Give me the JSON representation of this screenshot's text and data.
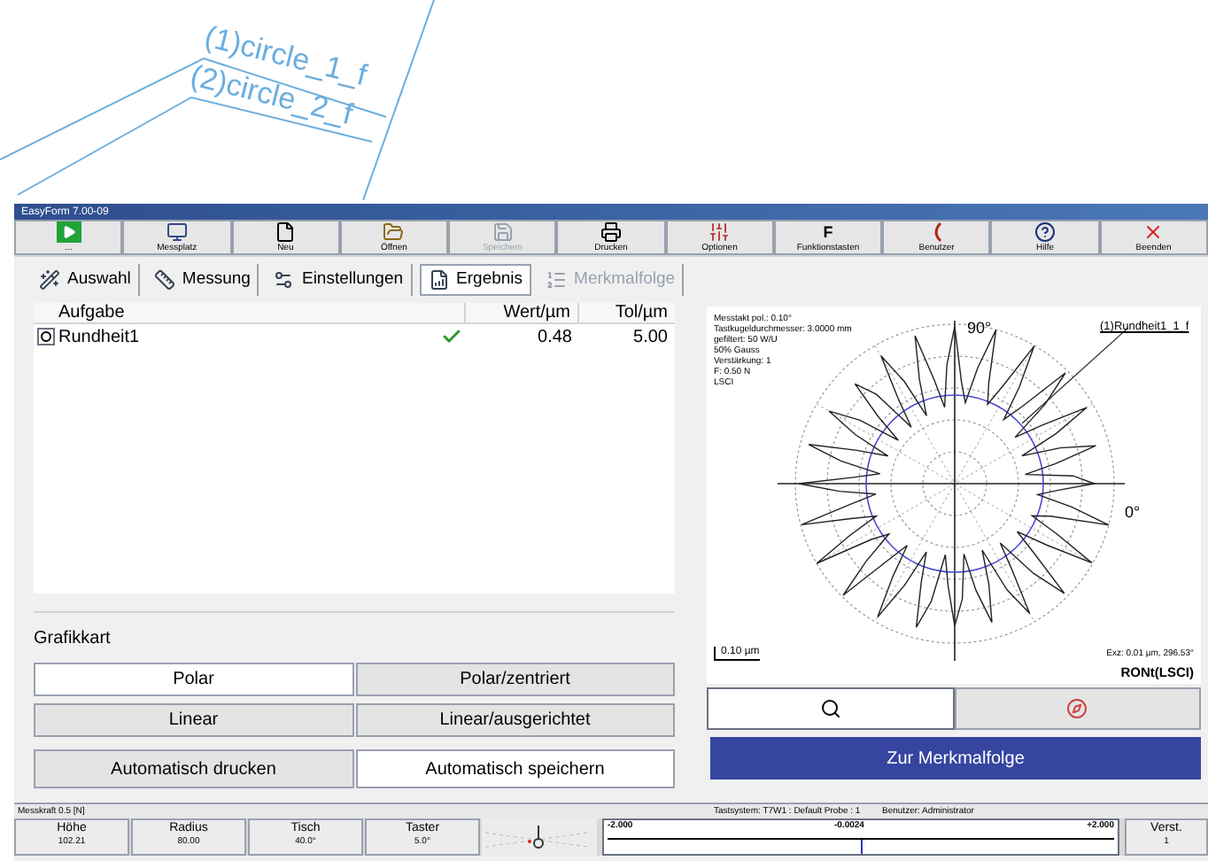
{
  "background_drawing": {
    "labels": [
      "(1)circle_1_f",
      "(2)circle_2_f"
    ]
  },
  "window": {
    "title": "EasyForm 7.00-09"
  },
  "toolbar": [
    {
      "kind": "run",
      "label": "...",
      "disabled": false
    },
    {
      "kind": "station",
      "label": "Messplatz",
      "disabled": false
    },
    {
      "kind": "new",
      "label": "Neu",
      "disabled": false
    },
    {
      "kind": "open",
      "label": "Öffnen",
      "disabled": false
    },
    {
      "kind": "save",
      "label": "Speichern",
      "disabled": true
    },
    {
      "kind": "print",
      "label": "Drucken",
      "disabled": false
    },
    {
      "kind": "options",
      "label": "Optionen",
      "disabled": false
    },
    {
      "kind": "keys",
      "glyph": "F",
      "label": "Funktionstasten",
      "disabled": false
    },
    {
      "kind": "user",
      "label": "Benutzer",
      "disabled": false
    },
    {
      "kind": "help",
      "label": "Hilfe",
      "disabled": false
    },
    {
      "kind": "exit",
      "label": "Beenden",
      "disabled": false
    }
  ],
  "tabs": [
    {
      "kind": "select",
      "label": "Auswahl",
      "selected": false,
      "disabled": false
    },
    {
      "kind": "measure",
      "label": "Messung",
      "selected": false,
      "disabled": false
    },
    {
      "kind": "settings",
      "label": "Einstellungen",
      "selected": false,
      "disabled": false
    },
    {
      "kind": "result",
      "label": "Ergebnis",
      "selected": true,
      "disabled": false
    },
    {
      "kind": "sequence",
      "label": "Merkmalfolge",
      "selected": false,
      "disabled": true
    }
  ],
  "table": {
    "columns": [
      "Aufgabe",
      "Wert/µm",
      "Tol/µm"
    ],
    "rows": [
      {
        "task": "Rundheit1",
        "ok": true,
        "value": "0.48",
        "tol": "5.00"
      }
    ]
  },
  "chart_type": {
    "title": "Grafikkart",
    "buttons": [
      {
        "label": "Polar",
        "selected": true
      },
      {
        "label": "Polar/zentriert",
        "selected": false
      },
      {
        "label": "Linear",
        "selected": false
      },
      {
        "label": "Linear/ausgerichtet",
        "selected": false
      },
      {
        "label": "Automatisch drucken",
        "selected": false
      },
      {
        "label": "Automatisch speichern",
        "selected": true
      }
    ]
  },
  "plot": {
    "info": [
      "Messtakt pol.: 0.10°",
      "Tastkugeldurchmesser: 3.0000 mm",
      "gefiltert: 50 W/U",
      "50% Gauss",
      "Verstärkung: 1",
      "F: 0.50 N",
      "LSCI"
    ],
    "label_90": "90°",
    "label_0": "0°",
    "feature": "(1)Rundheit1_1_f",
    "scale": "0.10 µm",
    "ecc": "Exz: 0.01 µm, 296.53°",
    "method": "RONt(LSCI)"
  },
  "next_button": "Zur Merkmalfolge",
  "status_bar": {
    "force": "Messkraft 0.5 [N]",
    "probe": "Tastsystem: T7W1 : Default Probe : 1",
    "user": "Benutzer: Administrator"
  },
  "readouts": [
    {
      "label": "Höhe",
      "value": "102.21"
    },
    {
      "label": "Radius",
      "value": "80.00"
    },
    {
      "label": "Tisch",
      "value": "40.0°"
    },
    {
      "label": "Taster",
      "value": "5.0°"
    }
  ],
  "gauge": {
    "min": "-2.000",
    "value": "-0.0024",
    "max": "+2.000",
    "level": 0.5
  },
  "gain": {
    "label": "Verst.",
    "value": "1"
  }
}
